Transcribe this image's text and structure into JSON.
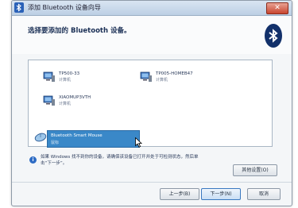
{
  "window": {
    "title": "添加 Bluetooth 设备向导",
    "close_glyph": "✕"
  },
  "header": {
    "heading": "选择要添加的 Bluetooth 设备。"
  },
  "devices": [
    {
      "name": "TP500-33",
      "status": "计算机",
      "icon": "computer-icon"
    },
    {
      "name": "TP005-HOMEB47",
      "status": "计算机",
      "icon": "computer-icon"
    },
    {
      "name": "XIAOMUP3VTH",
      "status": "计算机",
      "icon": "computer-icon"
    },
    {
      "name": "Bluetooth Smart Mouse",
      "status": "鼠标",
      "icon": "mouse-icon"
    }
  ],
  "info": {
    "text": "如果 Windows 找不到你的设备，请确保该设备已打开并处于可检测状态，然后单击“下一步”。"
  },
  "buttons": {
    "troubleshoot": "其他设置(O)",
    "back": "上一步(B)",
    "next": "下一步(N)",
    "cancel": "取消"
  },
  "colors": {
    "selection": "#3a88c8",
    "bluetooth_logo": "#12306a",
    "accent": "#2b62b8"
  }
}
